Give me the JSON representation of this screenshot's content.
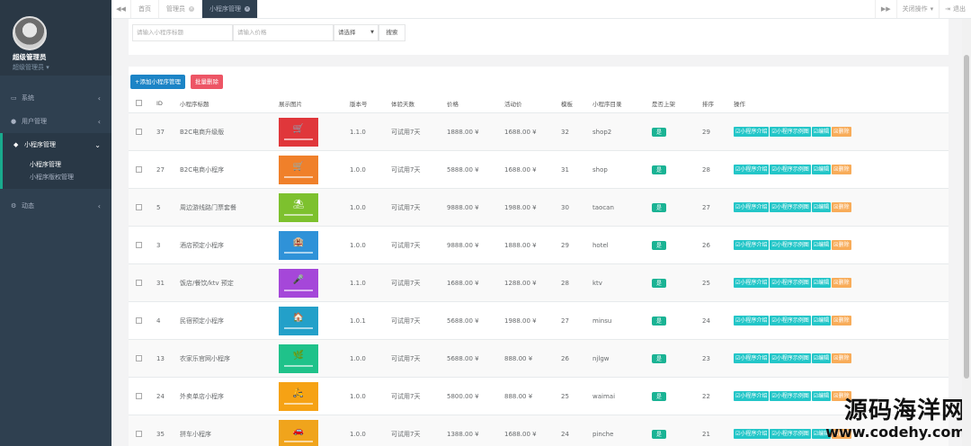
{
  "profile": {
    "name": "超级管理员",
    "role": "超级管理员 ▾"
  },
  "sidebar": {
    "items": [
      {
        "label": "系统",
        "icon": "desktop-icon"
      },
      {
        "label": "用户管理",
        "icon": "user-icon"
      },
      {
        "label": "小程序管理",
        "icon": "comments-icon"
      },
      {
        "label": "动态",
        "icon": "cogs-icon"
      }
    ],
    "subitems": [
      {
        "label": "小程序管理"
      },
      {
        "label": "小程序版权管理"
      }
    ]
  },
  "tabs": {
    "items": [
      {
        "label": "首页"
      },
      {
        "label": "管理员"
      },
      {
        "label": "小程序管理"
      }
    ],
    "close_ops": "关闭操作",
    "exit": "退出"
  },
  "search": {
    "name_placeholder": "请输入小程序标题",
    "price_placeholder": "请输入价格",
    "select_value": "请选择",
    "button": "搜索"
  },
  "toolbar": {
    "add": "+添加小程序管理",
    "batch_delete": "批量删除"
  },
  "columns": [
    "ID",
    "小程序标题",
    "展示图片",
    "版本号",
    "体验天数",
    "价格",
    "活动价",
    "模板",
    "小程序目录",
    "是否上架",
    "排序",
    "操作"
  ],
  "rows": [
    {
      "id": "37",
      "title": "B2C电商升级版",
      "version": "1.1.0",
      "days": "可试用7天",
      "price": "1888.00 ¥",
      "sale": "1688.00 ¥",
      "tpl": "32",
      "dir": "shop2",
      "sort": "29",
      "thumb_color": "#e0373b",
      "thumb_glyph": "🛒"
    },
    {
      "id": "27",
      "title": "B2C电商小程序",
      "version": "1.0.0",
      "days": "可试用7天",
      "price": "5888.00 ¥",
      "sale": "1688.00 ¥",
      "tpl": "31",
      "dir": "shop",
      "sort": "28",
      "thumb_color": "#f0802a",
      "thumb_glyph": "🛒"
    },
    {
      "id": "5",
      "title": "周边游线路门票套餐",
      "version": "1.0.0",
      "days": "可试用7天",
      "price": "9888.00 ¥",
      "sale": "1988.00 ¥",
      "tpl": "30",
      "dir": "taocan",
      "sort": "27",
      "thumb_color": "#7dc12e",
      "thumb_glyph": "⛱"
    },
    {
      "id": "3",
      "title": "酒店预定小程序",
      "version": "1.0.0",
      "days": "可试用7天",
      "price": "9888.00 ¥",
      "sale": "1888.00 ¥",
      "tpl": "29",
      "dir": "hotel",
      "sort": "26",
      "thumb_color": "#2f92d8",
      "thumb_glyph": "🏨"
    },
    {
      "id": "31",
      "title": "饭店/餐饮/ktv 预定",
      "version": "1.1.0",
      "days": "可试用7天",
      "price": "1688.00 ¥",
      "sale": "1288.00 ¥",
      "tpl": "28",
      "dir": "ktv",
      "sort": "25",
      "thumb_color": "#a547d9",
      "thumb_glyph": "🎤"
    },
    {
      "id": "4",
      "title": "民宿预定小程序",
      "version": "1.0.1",
      "days": "可试用7天",
      "price": "5688.00 ¥",
      "sale": "1988.00 ¥",
      "tpl": "27",
      "dir": "minsu",
      "sort": "24",
      "thumb_color": "#23a0c9",
      "thumb_glyph": "🏠"
    },
    {
      "id": "13",
      "title": "农家乐官网小程序",
      "version": "1.0.0",
      "days": "可试用7天",
      "price": "5688.00 ¥",
      "sale": "888.00 ¥",
      "tpl": "26",
      "dir": "njlgw",
      "sort": "23",
      "thumb_color": "#1fc28a",
      "thumb_glyph": "🌿"
    },
    {
      "id": "24",
      "title": "外卖单店小程序",
      "version": "1.0.0",
      "days": "可试用7天",
      "price": "5800.00 ¥",
      "sale": "888.00 ¥",
      "tpl": "25",
      "dir": "waimai",
      "sort": "22",
      "thumb_color": "#f6a214",
      "thumb_glyph": "🛵"
    },
    {
      "id": "35",
      "title": "拼车小程序",
      "version": "1.0.0",
      "days": "可试用7天",
      "price": "1388.00 ¥",
      "sale": "1688.00 ¥",
      "tpl": "24",
      "dir": "pinche",
      "sort": "21",
      "thumb_color": "#f0a41c",
      "thumb_glyph": "🚗"
    }
  ],
  "row_status": "是",
  "ops": [
    "☑小程序介绍",
    "☑小程序示例图",
    "☑编辑",
    "☒删除"
  ],
  "watermark": {
    "cn": "源码海洋网",
    "url": "www.codehy.com"
  },
  "colors": {
    "sidebar": "#2f4050",
    "accent": "#1ab394",
    "info": "#23c6c8",
    "warning": "#f8ac59",
    "primary": "#1c84c6",
    "danger": "#ed5565"
  }
}
